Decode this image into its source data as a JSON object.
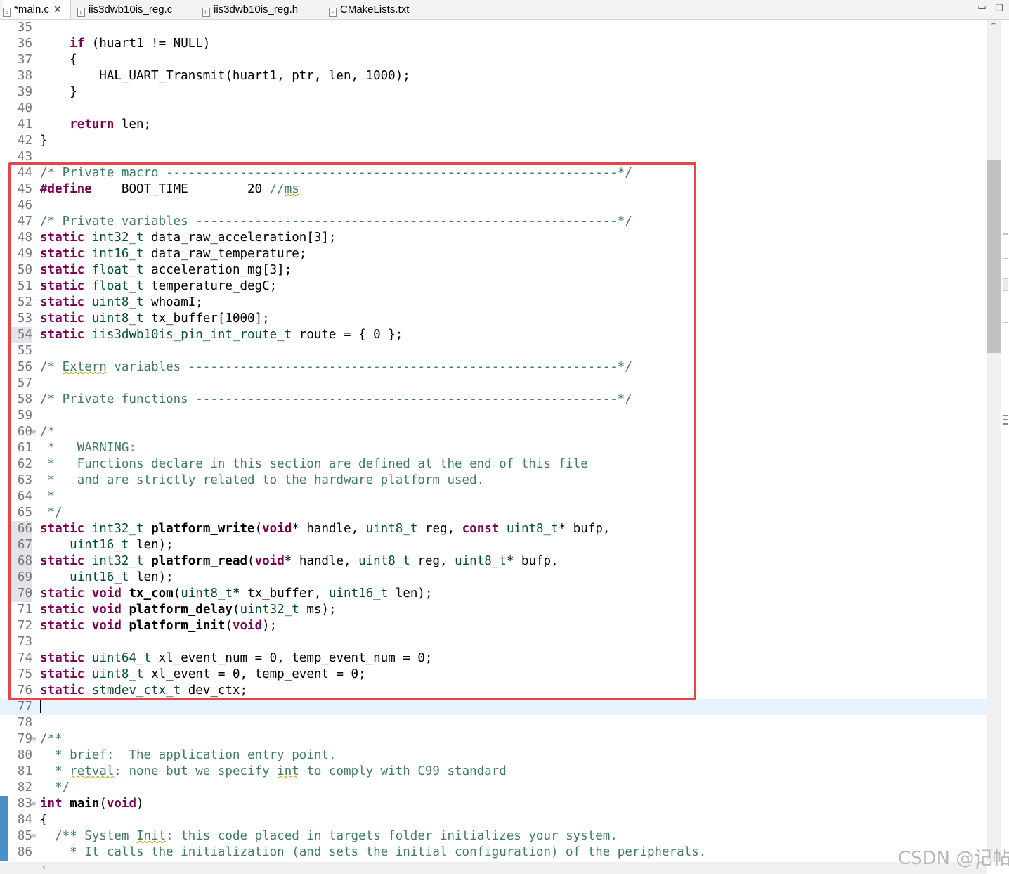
{
  "tabs": [
    {
      "label": "*main.c",
      "closable": true,
      "active": true
    },
    {
      "label": "iis3dwb10is_reg.c"
    },
    {
      "label": "iis3dwb10is_reg.h"
    },
    {
      "label": "CMakeLists.txt"
    }
  ],
  "window_buttons": {
    "minimize": "▭",
    "maximize": "▢"
  },
  "editor": {
    "current_line": 77,
    "highlight_region": {
      "first_line": 44,
      "last_line": 76
    },
    "lines": [
      {
        "n": "35",
        "code": ""
      },
      {
        "n": "36",
        "code": "    if (huart1 != NULL)"
      },
      {
        "n": "37",
        "code": "    {"
      },
      {
        "n": "38",
        "code": "        HAL_UART_Transmit(huart1, ptr, len, 1000);"
      },
      {
        "n": "39",
        "code": "    }"
      },
      {
        "n": "40",
        "code": ""
      },
      {
        "n": "41",
        "code": "    return len;"
      },
      {
        "n": "42",
        "code": "}"
      },
      {
        "n": "43",
        "code": ""
      },
      {
        "n": "44",
        "code": "/* Private macro -------------------------------------------------------------*/"
      },
      {
        "n": "45",
        "code": "#define    BOOT_TIME        20 //ms"
      },
      {
        "n": "46",
        "code": ""
      },
      {
        "n": "47",
        "code": "/* Private variables ---------------------------------------------------------*/"
      },
      {
        "n": "48",
        "code": "static int32_t data_raw_acceleration[3];"
      },
      {
        "n": "49",
        "code": "static int16_t data_raw_temperature;"
      },
      {
        "n": "50",
        "code": "static float_t acceleration_mg[3];"
      },
      {
        "n": "51",
        "code": "static float_t temperature_degC;"
      },
      {
        "n": "52",
        "code": "static uint8_t whoamI;"
      },
      {
        "n": "53",
        "code": "static uint8_t tx_buffer[1000];"
      },
      {
        "n": "54",
        "code": "static iis3dwb10is_pin_int_route_t route = { 0 };"
      },
      {
        "n": "55",
        "code": ""
      },
      {
        "n": "56",
        "code": "/* Extern variables ----------------------------------------------------------*/"
      },
      {
        "n": "57",
        "code": ""
      },
      {
        "n": "58",
        "code": "/* Private functions ---------------------------------------------------------*/"
      },
      {
        "n": "59",
        "code": ""
      },
      {
        "n": "60",
        "code": "/*"
      },
      {
        "n": "61",
        "code": " *   WARNING:"
      },
      {
        "n": "62",
        "code": " *   Functions declare in this section are defined at the end of this file"
      },
      {
        "n": "63",
        "code": " *   and are strictly related to the hardware platform used."
      },
      {
        "n": "64",
        "code": " *"
      },
      {
        "n": "65",
        "code": " */"
      },
      {
        "n": "66",
        "code": "static int32_t platform_write(void* handle, uint8_t reg, const uint8_t* bufp,"
      },
      {
        "n": "67",
        "code": "    uint16_t len);"
      },
      {
        "n": "68",
        "code": "static int32_t platform_read(void* handle, uint8_t reg, uint8_t* bufp,"
      },
      {
        "n": "69",
        "code": "    uint16_t len);"
      },
      {
        "n": "70",
        "code": "static void tx_com(uint8_t* tx_buffer, uint16_t len);"
      },
      {
        "n": "71",
        "code": "static void platform_delay(uint32_t ms);"
      },
      {
        "n": "72",
        "code": "static void platform_init(void);"
      },
      {
        "n": "73",
        "code": ""
      },
      {
        "n": "74",
        "code": "static uint64_t xl_event_num = 0, temp_event_num = 0;"
      },
      {
        "n": "75",
        "code": "static uint8_t xl_event = 0, temp_event = 0;"
      },
      {
        "n": "76",
        "code": "static stmdev_ctx_t dev_ctx;"
      },
      {
        "n": "77",
        "code": ""
      },
      {
        "n": "78",
        "code": ""
      },
      {
        "n": "79",
        "code": "/**"
      },
      {
        "n": "80",
        "code": "  * brief:  The application entry point."
      },
      {
        "n": "81",
        "code": "  * retval: none but we specify int to comply with C99 standard"
      },
      {
        "n": "82",
        "code": "  */"
      },
      {
        "n": "83",
        "code": "int main(void)"
      },
      {
        "n": "84",
        "code": "{"
      },
      {
        "n": "85",
        "code": "  /** System Init: this code placed in targets folder initializes your system."
      },
      {
        "n": "86",
        "code": "    * It calls the initialization (and sets the initial configuration) of the peripherals."
      }
    ]
  },
  "watermark": "CSDN @记帖"
}
